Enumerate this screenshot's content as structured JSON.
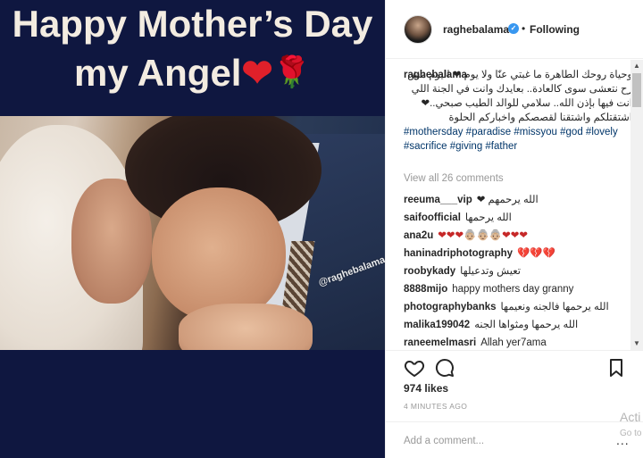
{
  "media": {
    "title_line1": "Happy Mother’s Day",
    "title_line2": "my Angel",
    "heart_glyph": "❤",
    "rose_glyph": "🌹",
    "watermark": "@raghebalama"
  },
  "header": {
    "username": "raghebalama",
    "verified_glyph": "✓",
    "separator": "•",
    "follow_status": "Following"
  },
  "caption": {
    "username": "raghebalama",
    "text_ar": "وحياة روحك الطاهرة ما غبتي عنّا ولا يوم ❤ اليوم مش رح نتعشى سوى كالعادة.. بعايدك وانت في الجنة اللي انت فيها بإذن الله.. سلامي للوالد الطيب صبحي..❤ اشتقتلكم واشتقنا لقصصكم واخباركم الحلوة",
    "hashtags": "#mothersday #paradise #missyou #god #lovely #sacrifice #giving #father"
  },
  "view_all": "View all 26 comments",
  "comments": [
    {
      "user": "reeuma___vip",
      "text": "الله يرحمهم ❤"
    },
    {
      "user": "saifoofficial",
      "text": "الله يرحمها"
    },
    {
      "user": "ana2u",
      "text": "❤❤❤👵🏼👵🏼👵🏼❤❤❤"
    },
    {
      "user": "haninadriphotography",
      "text": "💔💔💔"
    },
    {
      "user": "roobykady",
      "text": "تعيش وتدعيلها"
    },
    {
      "user": "8888mijo",
      "text": "happy mothers day granny"
    },
    {
      "user": "photographybanks",
      "text": "الله يرحمها فالجنه ونعيمها"
    },
    {
      "user": "malika199042",
      "text": "الله يرحمها ومثواها الجنه"
    },
    {
      "user": "raneemelmasri",
      "text": "Allah yer7ama"
    }
  ],
  "actions": {
    "like_icon": "heart-outline-icon",
    "comment_icon": "comment-bubble-icon",
    "save_icon": "bookmark-icon"
  },
  "likes": "974 likes",
  "timestamp": "4 MINUTES AGO",
  "add_comment": {
    "placeholder": "Add a comment...",
    "more": "..."
  },
  "os_overlay": {
    "line1": "Acti",
    "line2": "Go to"
  },
  "colors": {
    "media_bg": "#0f1740",
    "hashtag": "#003569",
    "verified": "#3897f0",
    "muted": "#999999"
  }
}
